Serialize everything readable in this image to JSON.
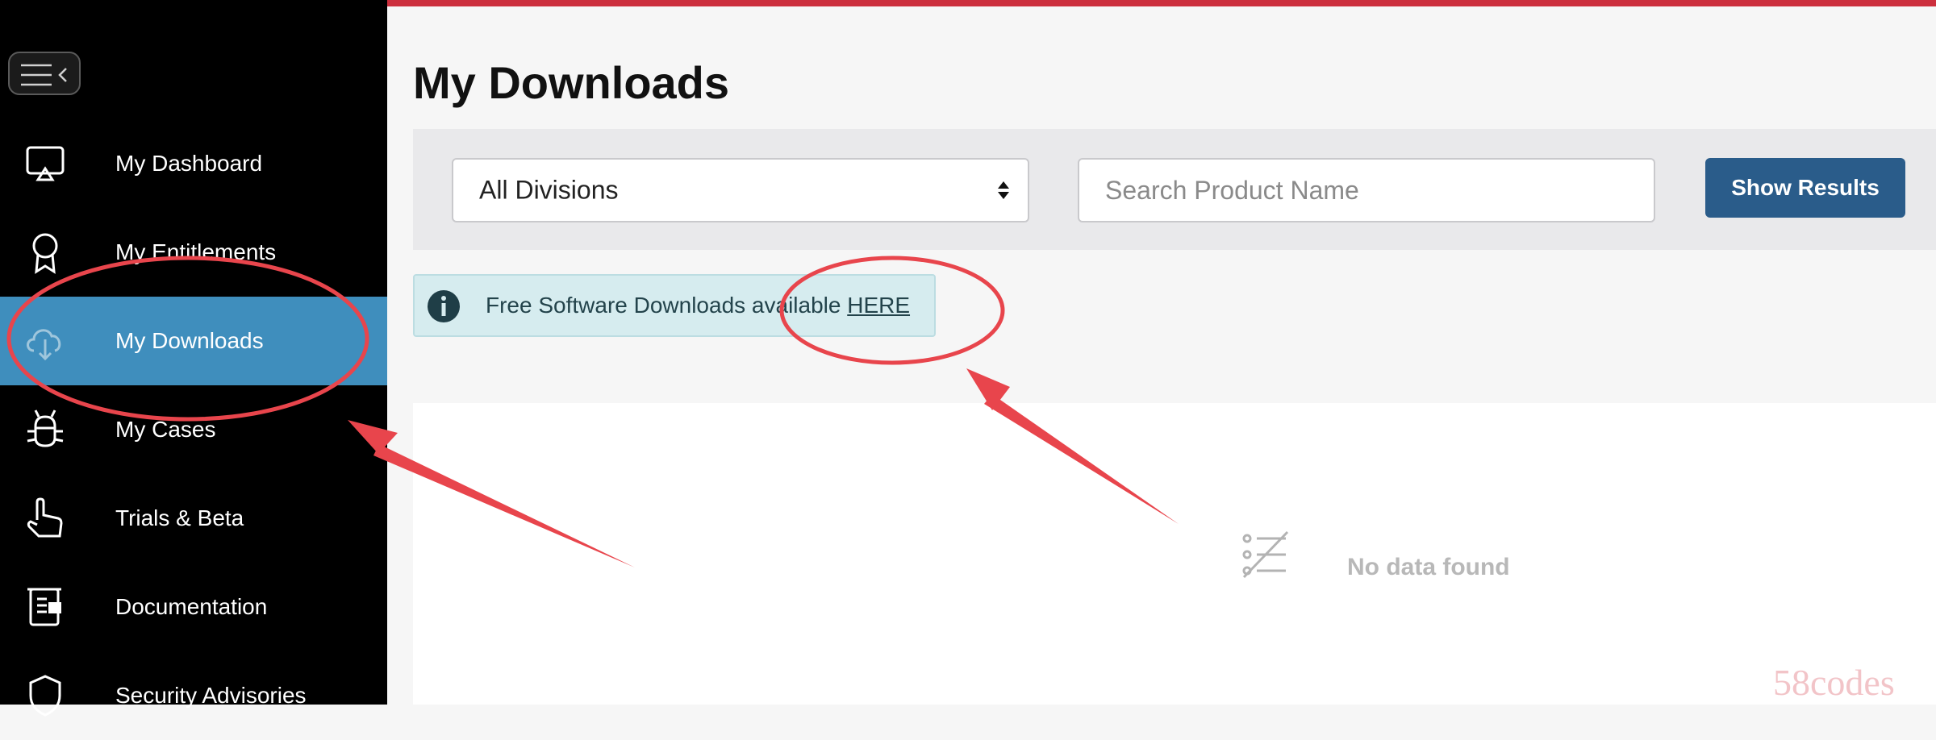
{
  "sidebar": {
    "items": [
      {
        "label": "My Dashboard",
        "icon": "dashboard-icon"
      },
      {
        "label": "My Entitlements",
        "icon": "award-icon"
      },
      {
        "label": "My Downloads",
        "icon": "cloud-download-icon",
        "active": true
      },
      {
        "label": "My Cases",
        "icon": "bug-icon"
      },
      {
        "label": "Trials & Beta",
        "icon": "pointer-hand-icon"
      },
      {
        "label": "Documentation",
        "icon": "scroll-icon"
      },
      {
        "label": "Security Advisories",
        "icon": "shield-icon"
      }
    ]
  },
  "main": {
    "title": "My Downloads",
    "filters": {
      "division_value": "All Divisions",
      "search_placeholder": "Search Product Name",
      "show_results_label": "Show Results"
    },
    "info": {
      "text": "Free Software Downloads available",
      "link": "HERE"
    },
    "results": {
      "empty_text": "No data found"
    }
  },
  "watermark": "58codes",
  "colors": {
    "brand_red": "#cc2f3d",
    "sidebar_active": "#3f8ebd",
    "button_blue": "#2a5c8a",
    "annotation_red": "#e8454c"
  }
}
